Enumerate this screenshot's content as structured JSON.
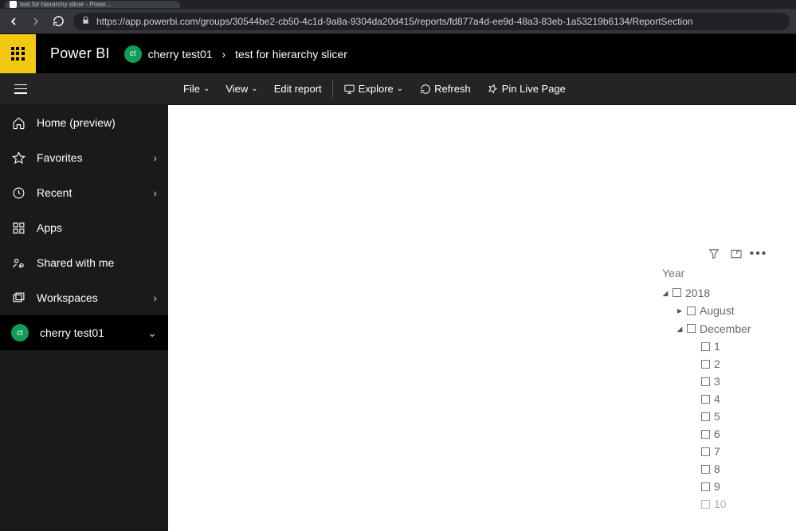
{
  "chrome": {
    "tab_title": "test for hierarchy slicer - Powe...",
    "url": "https://app.powerbi.com/groups/30544be2-cb50-4c1d-9a8a-9304da20d415/reports/fd877a4d-ee9d-48a3-83eb-1a53219b6134/ReportSection"
  },
  "header": {
    "brand": "Power BI",
    "workspace_badge": "ct",
    "workspace_name": "cherry test01",
    "report_name": "test for hierarchy slicer"
  },
  "toolbar": {
    "file": "File",
    "view": "View",
    "edit": "Edit report",
    "explore": "Explore",
    "refresh": "Refresh",
    "pin": "Pin Live Page"
  },
  "sidebar": {
    "items": [
      {
        "label": "Home (preview)"
      },
      {
        "label": "Favorites"
      },
      {
        "label": "Recent"
      },
      {
        "label": "Apps"
      },
      {
        "label": "Shared with me"
      },
      {
        "label": "Workspaces"
      }
    ],
    "current_ws_badge": "ct",
    "current_ws": "cherry test01"
  },
  "slicer": {
    "title": "Year",
    "year": "2018",
    "months": {
      "collapsed": "August",
      "expanded": "December"
    },
    "days": [
      "1",
      "2",
      "3",
      "4",
      "5",
      "6",
      "7",
      "8",
      "9",
      "10"
    ]
  }
}
